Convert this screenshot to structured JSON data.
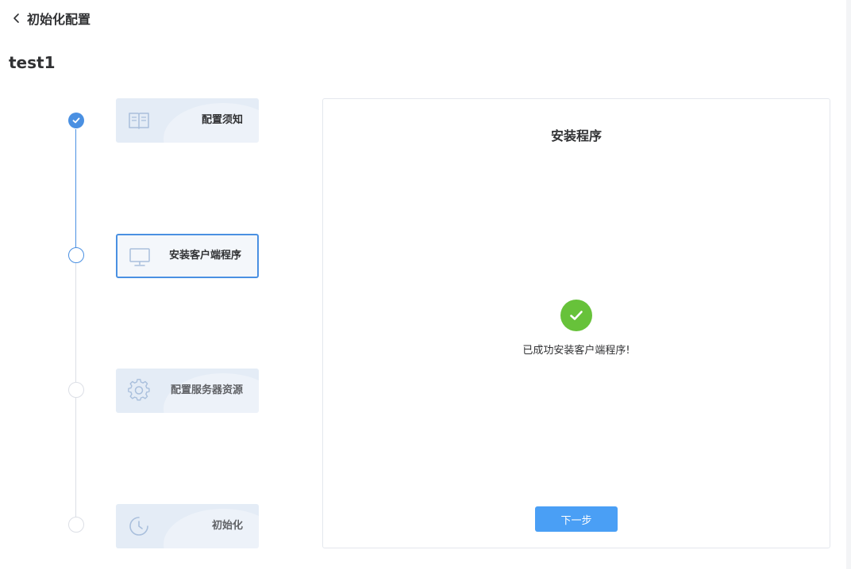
{
  "header": {
    "back_icon": "chevron-left-icon",
    "title": "初始化配置"
  },
  "project": {
    "name": "test1"
  },
  "steps": [
    {
      "label": "配置须知",
      "icon": "book-icon",
      "status": "done"
    },
    {
      "label": "安装客户端程序",
      "icon": "monitor-icon",
      "status": "active"
    },
    {
      "label": "配置服务器资源",
      "icon": "gear-icon",
      "status": "pending"
    },
    {
      "label": "初始化",
      "icon": "clock-icon",
      "status": "pending"
    }
  ],
  "panel": {
    "title": "安装程序",
    "success_icon": "check-circle-icon",
    "success_message": "已成功安装客户端程序!",
    "next_button": "下一步"
  },
  "colors": {
    "accent": "#4a90e2",
    "success": "#67c23a",
    "button": "#4a9ff5",
    "card_bg": "#e4ecf6"
  }
}
